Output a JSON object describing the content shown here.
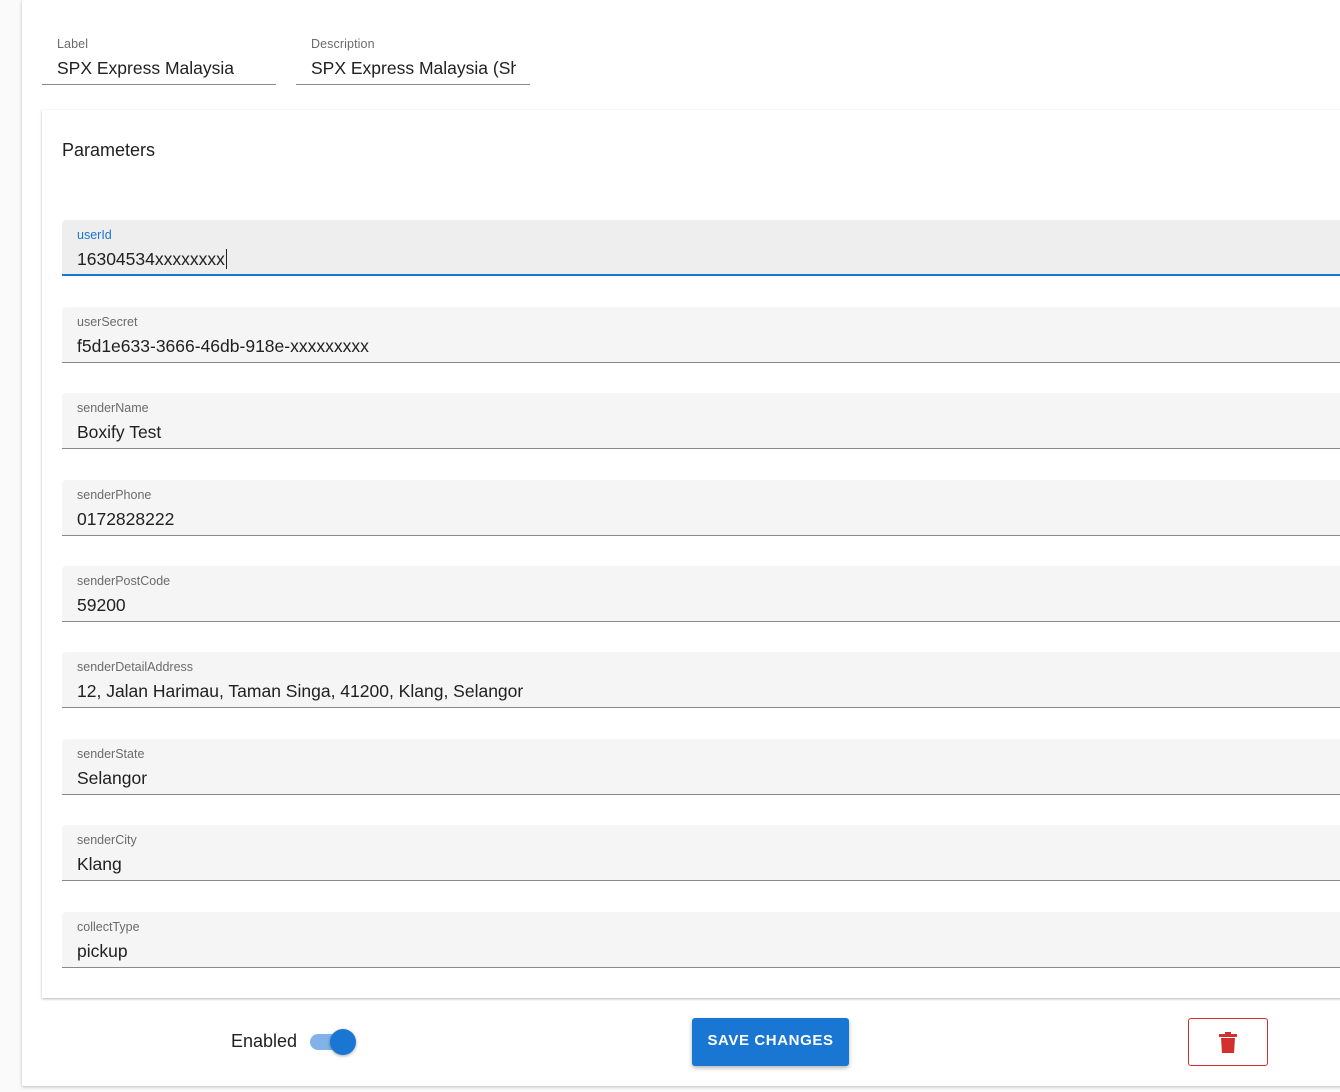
{
  "header": {
    "label": {
      "caption": "Label",
      "value": "SPX Express Malaysia"
    },
    "description": {
      "caption": "Description",
      "value": "SPX Express Malaysia (Sh"
    }
  },
  "parameters": {
    "title": "Parameters",
    "fields": [
      {
        "key": "userId",
        "value": "16304534xxxxxxxx"
      },
      {
        "key": "userSecret",
        "value": "f5d1e633-3666-46db-918e-xxxxxxxxx"
      },
      {
        "key": "senderName",
        "value": "Boxify Test"
      },
      {
        "key": "senderPhone",
        "value": "0172828222"
      },
      {
        "key": "senderPostCode",
        "value": "59200"
      },
      {
        "key": "senderDetailAddress",
        "value": "12, Jalan Harimau, Taman Singa, 41200, Klang, Selangor"
      },
      {
        "key": "senderState",
        "value": "Selangor"
      },
      {
        "key": "senderCity",
        "value": "Klang"
      },
      {
        "key": "collectType",
        "value": "pickup"
      }
    ]
  },
  "footer": {
    "enabled_label": "Enabled",
    "enabled": true,
    "save_label": "SAVE CHANGES",
    "delete_icon": "trash-icon"
  },
  "colors": {
    "primary": "#1976d2",
    "danger": "#d32f2f"
  }
}
